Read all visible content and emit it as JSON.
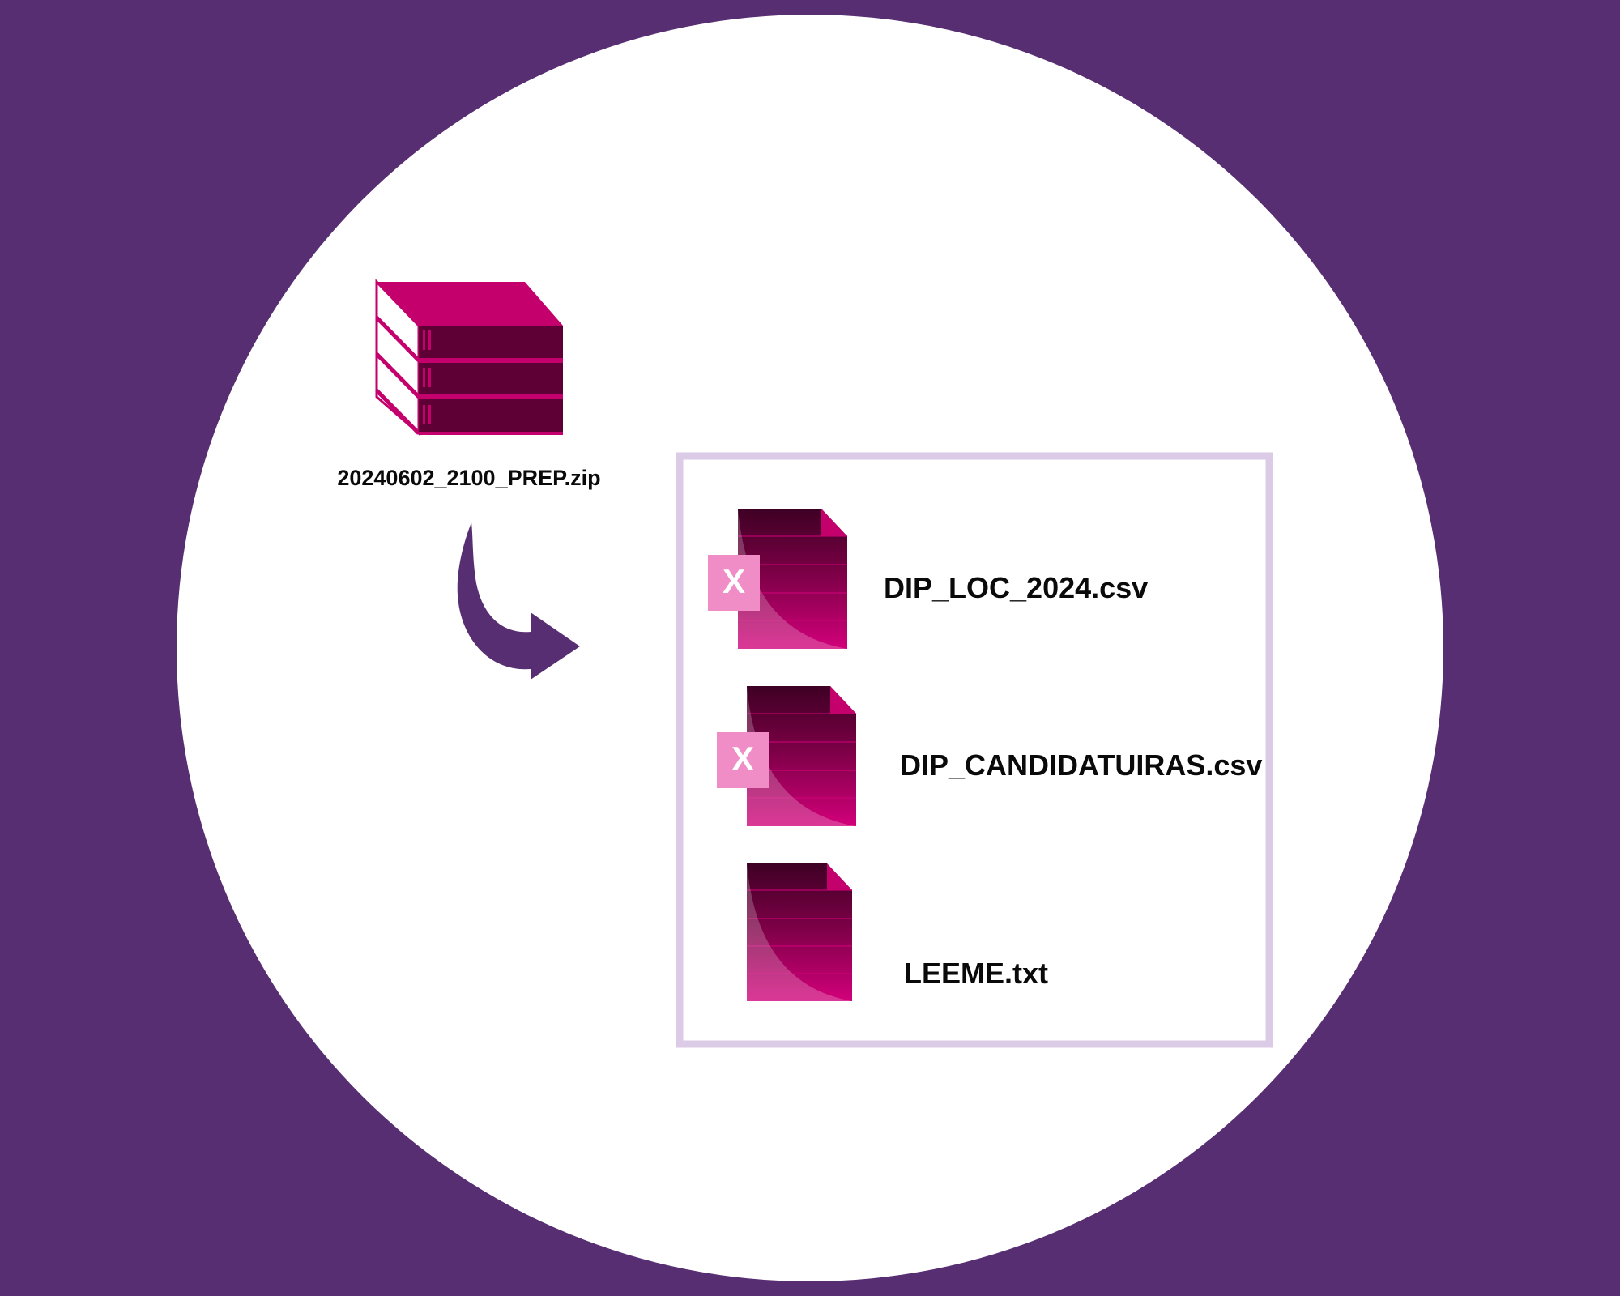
{
  "archive": {
    "filename": "20240602_2100_PREP.zip",
    "icon": "zip-archive-icon"
  },
  "contents": {
    "files": [
      {
        "name": "DIP_LOC_2024.csv",
        "type": "csv",
        "icon": "csv-spreadsheet-icon",
        "badge": "X"
      },
      {
        "name": "DIP_CANDIDATUIRAS.csv",
        "type": "csv",
        "icon": "csv-spreadsheet-icon",
        "badge": "X"
      },
      {
        "name": "LEEME.txt",
        "type": "txt",
        "icon": "text-document-icon"
      }
    ]
  },
  "colors": {
    "background": "#572e72",
    "circle": "#ffffff",
    "box_border": "#dccbe6",
    "arrow": "#572e72",
    "magenta": "#c4006c",
    "dark_plum": "#5e0035",
    "badge": "#f08cc6"
  }
}
